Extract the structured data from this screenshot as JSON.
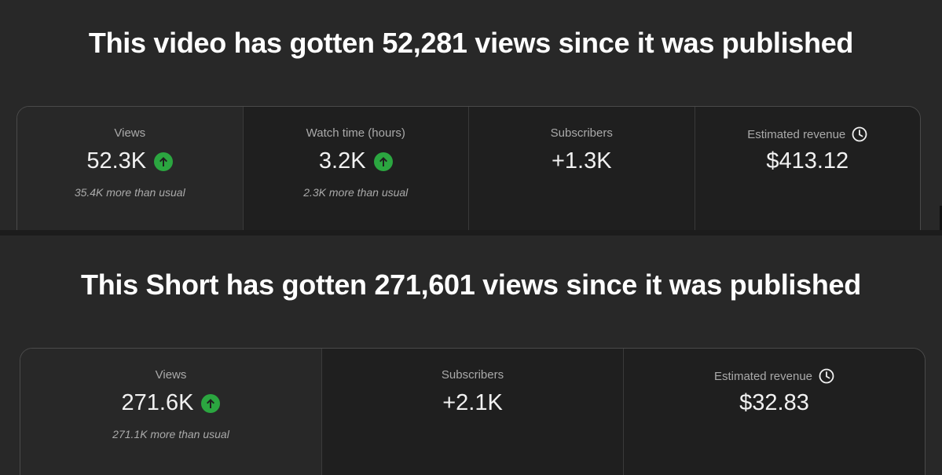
{
  "video": {
    "headline": "This video has gotten 52,281 views since it was published",
    "metrics": [
      {
        "label": "Views",
        "value": "52.3K",
        "note": "35.4K more than usual",
        "trend_icon": "arrow-up-circle-icon"
      },
      {
        "label": "Watch time (hours)",
        "value": "3.2K",
        "note": "2.3K more than usual",
        "trend_icon": "arrow-up-circle-icon"
      },
      {
        "label": "Subscribers",
        "value": "+1.3K"
      },
      {
        "label": "Estimated revenue",
        "value": "$413.12",
        "label_icon": "clock-icon"
      }
    ]
  },
  "short": {
    "headline": "This Short has gotten 271,601 views since it was published",
    "metrics": [
      {
        "label": "Views",
        "value": "271.6K",
        "note": "271.1K more than usual",
        "trend_icon": "arrow-up-circle-icon"
      },
      {
        "label": "Subscribers",
        "value": "+2.1K"
      },
      {
        "label": "Estimated revenue",
        "value": "$32.83",
        "label_icon": "clock-icon"
      }
    ]
  },
  "colors": {
    "background": "#282828",
    "card_cell": "#1f1f1f",
    "trend_up": "#2ba640",
    "text_primary": "#f1f1f1",
    "text_secondary": "#aaaaaa"
  }
}
